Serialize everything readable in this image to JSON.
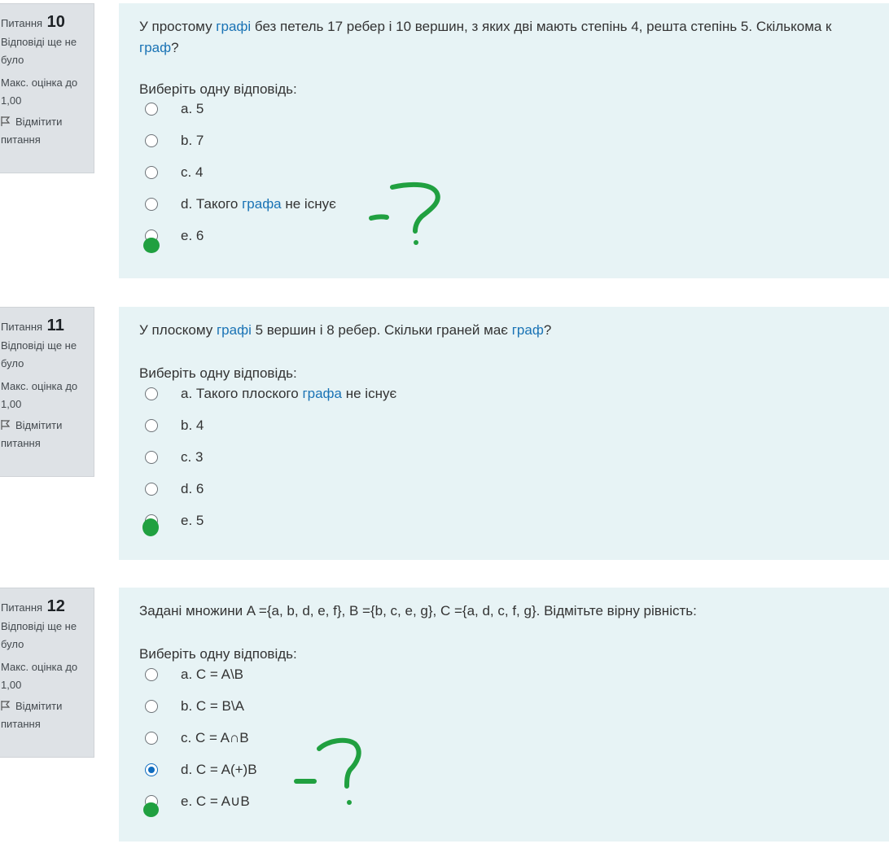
{
  "questions": [
    {
      "label": "Питання",
      "number": "10",
      "status": "Відповіді ще не було",
      "grade": "Макс. оцінка до 1,00",
      "flag": "Відмітити питання",
      "text_before_link": "У простому ",
      "text_link": "графі",
      "text_after_link": " без петель 17 ребер і 10 вершин, з яких дві мають степінь 4, решта степінь 5. Скількома к",
      "text_line2_link": "граф",
      "text_line2_after": "?",
      "prompt": "Виберіть одну відповідь:",
      "answers": [
        {
          "label": "a. 5"
        },
        {
          "label": "b. 7"
        },
        {
          "label": "c. 4"
        },
        {
          "prefix": "d. Такого ",
          "link": "графа",
          "suffix": " не існує"
        },
        {
          "label": "e. 6"
        }
      ]
    },
    {
      "label": "Питання",
      "number": "11",
      "status": "Відповіді ще не було",
      "grade": "Макс. оцінка до 1,00",
      "flag": "Відмітити питання",
      "text_p1": "У плоскому ",
      "text_link1": "графі",
      "text_p2": " 5 вершин і 8 ребер. Скільки граней має ",
      "text_link2": "граф",
      "text_p3": "?",
      "prompt": "Виберіть одну відповідь:",
      "answers": [
        {
          "prefix": "a. Такого плоского ",
          "link": "графа",
          "suffix": " не існує"
        },
        {
          "label": "b. 4"
        },
        {
          "label": "c. 3"
        },
        {
          "label": "d. 6"
        },
        {
          "label": "e. 5"
        }
      ]
    },
    {
      "label": "Питання",
      "number": "12",
      "status": "Відповіді ще не було",
      "grade": "Макс. оцінка до 1,00",
      "flag": "Відмітити питання",
      "text": "Задані множини A ={a, b, d, e, f}, B ={b, c, e, g}, C ={a, d, c, f, g}. Відмітьте вірну рівність:",
      "prompt": "Виберіть одну відповідь:",
      "answers": [
        {
          "label": "a. C = A\\B"
        },
        {
          "label": "b. C = B\\A"
        },
        {
          "label": "c. C = A∩B"
        },
        {
          "label": "d. C = A(+)B",
          "selected": true
        },
        {
          "label": "e. C = A∪B"
        }
      ]
    }
  ],
  "annotation_color": "#20a040"
}
